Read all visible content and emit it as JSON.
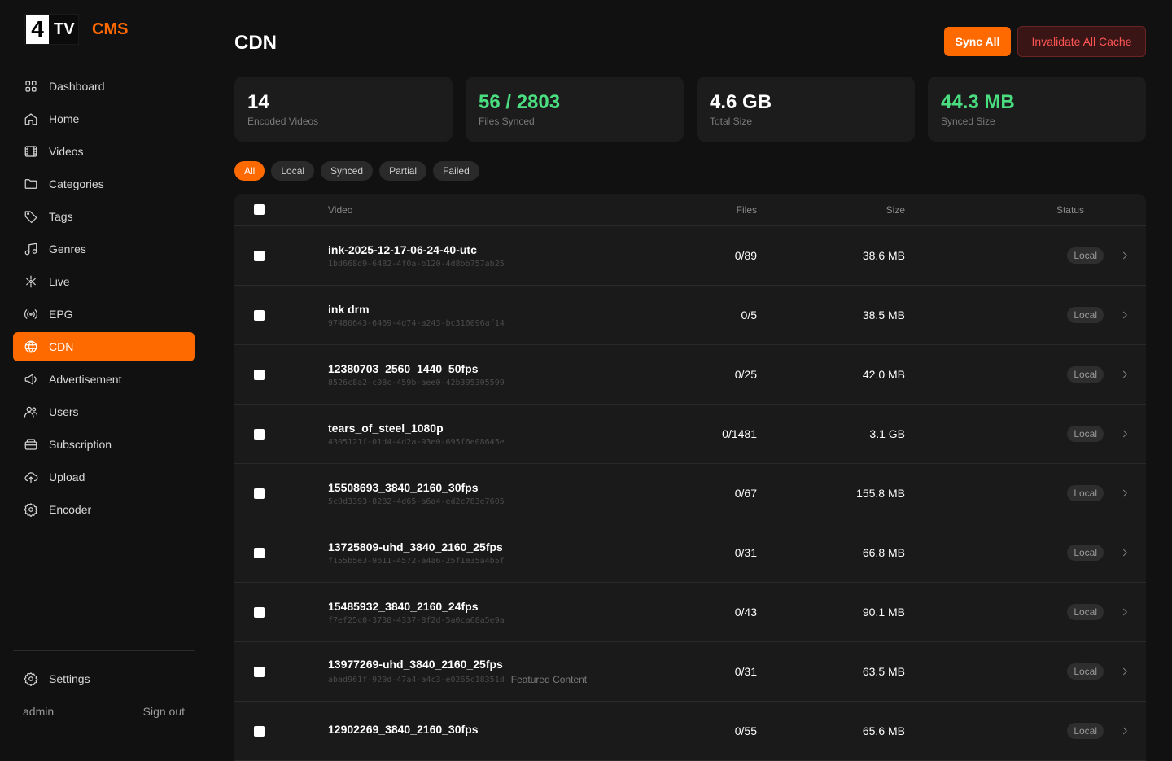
{
  "brand": {
    "logo_digit": "4",
    "logo_text": "TV",
    "product": "CMS",
    "accent": "#ff6a00"
  },
  "nav": [
    {
      "label": "Dashboard",
      "icon": "grid-icon"
    },
    {
      "label": "Home",
      "icon": "home-icon"
    },
    {
      "label": "Videos",
      "icon": "film-icon"
    },
    {
      "label": "Categories",
      "icon": "folder-icon"
    },
    {
      "label": "Tags",
      "icon": "tag-icon"
    },
    {
      "label": "Genres",
      "icon": "music-icon"
    },
    {
      "label": "Live",
      "icon": "live-icon"
    },
    {
      "label": "EPG",
      "icon": "broadcast-icon"
    },
    {
      "label": "CDN",
      "icon": "globe-icon",
      "active": true
    },
    {
      "label": "Advertisement",
      "icon": "megaphone-icon"
    },
    {
      "label": "Users",
      "icon": "users-icon"
    },
    {
      "label": "Subscription",
      "icon": "wallet-icon"
    },
    {
      "label": "Upload",
      "icon": "cloud-upload-icon"
    },
    {
      "label": "Encoder",
      "icon": "gear-icon"
    }
  ],
  "settings_label": "Settings",
  "footer": {
    "user": "admin",
    "sign_out": "Sign out"
  },
  "page": {
    "title": "CDN",
    "sync_all": "Sync All",
    "invalidate": "Invalidate All Cache"
  },
  "stats": [
    {
      "value": "14",
      "label": "Encoded Videos",
      "color": "#ffffff"
    },
    {
      "value": "56 / 2803",
      "label": "Files Synced",
      "color": "#4ade80"
    },
    {
      "value": "4.6 GB",
      "label": "Total Size",
      "color": "#ffffff"
    },
    {
      "value": "44.3 MB",
      "label": "Synced Size",
      "color": "#4ade80"
    }
  ],
  "filters": [
    "All",
    "Local",
    "Synced",
    "Partial",
    "Failed"
  ],
  "active_filter": "All",
  "table": {
    "headers": {
      "video": "Video",
      "files": "Files",
      "size": "Size",
      "status": "Status"
    },
    "rows": [
      {
        "title": "ink-2025-12-17-06-24-40-utc",
        "id": "1bd668d9-6482-4f0a-b120-4d8bb757ab25",
        "tag": "",
        "files": "0/89",
        "size": "38.6 MB",
        "status": "Local"
      },
      {
        "title": "ink drm",
        "id": "97480643-6469-4d74-a243-bc316096af14",
        "tag": "",
        "files": "0/5",
        "size": "38.5 MB",
        "status": "Local"
      },
      {
        "title": "12380703_2560_1440_50fps",
        "id": "8526c8a2-c08c-459b-aee0-42b395305599",
        "tag": "",
        "files": "0/25",
        "size": "42.0 MB",
        "status": "Local"
      },
      {
        "title": "tears_of_steel_1080p",
        "id": "4305121f-01d4-4d2a-93e0-695f6e08645e",
        "tag": "",
        "files": "0/1481",
        "size": "3.1 GB",
        "status": "Local"
      },
      {
        "title": "15508693_3840_2160_30fps",
        "id": "5c0d3393-8282-4d65-a6a4-ed2c783e7605",
        "tag": "",
        "files": "0/67",
        "size": "155.8 MB",
        "status": "Local"
      },
      {
        "title": "13725809-uhd_3840_2160_25fps",
        "id": "f155b5e3-9b11-4572-a4a6-25f1e35a4b5f",
        "tag": "",
        "files": "0/31",
        "size": "66.8 MB",
        "status": "Local"
      },
      {
        "title": "15485932_3840_2160_24fps",
        "id": "f7ef25c0-3738-4337-8f2d-5a0ca68a5e9a",
        "tag": "",
        "files": "0/43",
        "size": "90.1 MB",
        "status": "Local"
      },
      {
        "title": "13977269-uhd_3840_2160_25fps",
        "id": "abad961f-920d-47a4-a4c3-e0265c18351d",
        "tag": "Featured Content",
        "files": "0/31",
        "size": "63.5 MB",
        "status": "Local"
      },
      {
        "title": "12902269_3840_2160_30fps",
        "id": "",
        "tag": "",
        "files": "0/55",
        "size": "65.6 MB",
        "status": "Local"
      }
    ]
  }
}
